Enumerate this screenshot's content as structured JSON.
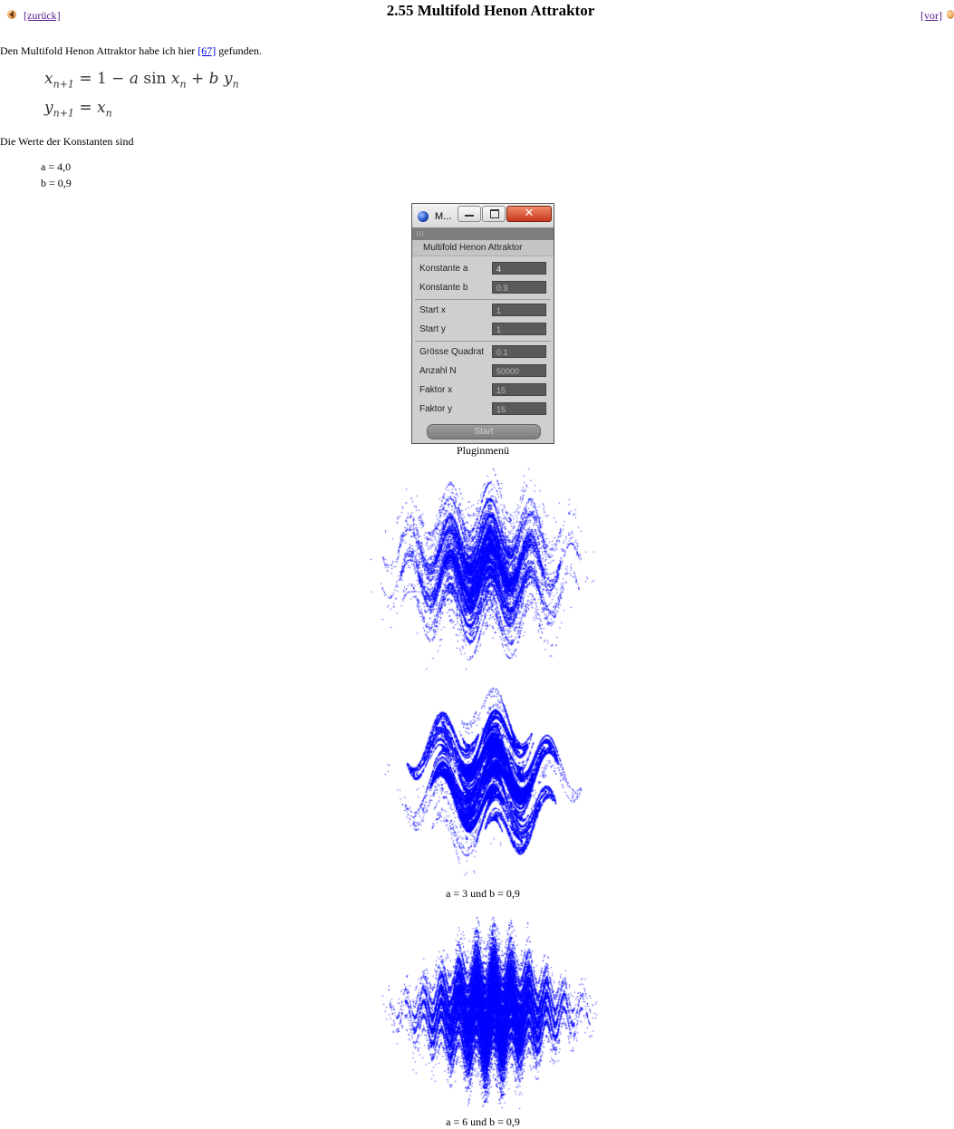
{
  "nav": {
    "back_label": "[zurück]",
    "forward_label": "[vor]"
  },
  "page_title": "2.55 Multifold Henon Attraktor",
  "intro": {
    "before": "Den Multifold Henon Attraktor habe ich hier ",
    "ref_label": "[67]",
    "after": " gefunden."
  },
  "constants_intro": "Die Werte der Konstanten sind",
  "constants": [
    "a = 4,0",
    "b = 0,9"
  ],
  "plugin": {
    "window_title": "M...",
    "header": "Multifold Henon Attraktor",
    "fields": [
      {
        "label": "Konstante a",
        "value": "4"
      },
      {
        "label": "Konstante b",
        "value": "0.9"
      },
      {
        "label": "Start x",
        "value": "1"
      },
      {
        "label": "Start y",
        "value": "1"
      },
      {
        "label": "Grösse Quadrat",
        "value": "0.1"
      },
      {
        "label": "Anzahl N",
        "value": "50000"
      },
      {
        "label": "Faktor x",
        "value": "15"
      },
      {
        "label": "Faktor y",
        "value": "15"
      }
    ],
    "start_label": "Start",
    "caption": "Pluginmenü"
  },
  "figures": [
    {
      "a": 4.0,
      "b": 0.9,
      "caption": ""
    },
    {
      "a": 3.0,
      "b": 0.9,
      "caption": "a = 3 und b = 0,9"
    },
    {
      "a": 6.0,
      "b": 0.9,
      "caption": "a = 6 und b = 0,9"
    }
  ],
  "colors": {
    "attractor": "#0000ff",
    "link_visited": "#551a8b",
    "link": "#0000ee"
  }
}
